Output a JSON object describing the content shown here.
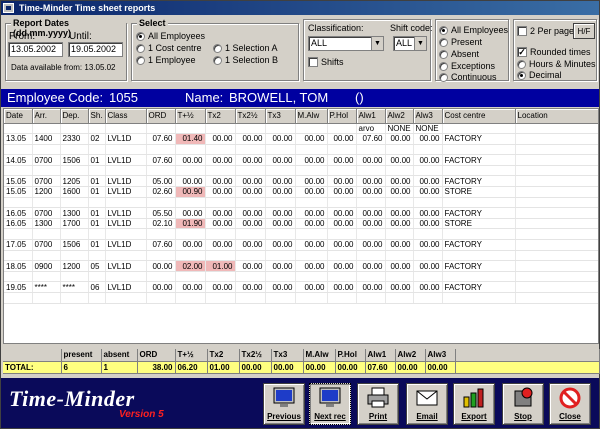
{
  "window": {
    "title": "Time-Minder Time sheet reports"
  },
  "report_dates": {
    "legend": "Report Dates (dd.mm.yyyy)",
    "from_label": "From:",
    "from_value": "13.05.2002",
    "until_label": "Until:",
    "until_value": "19.05.2002",
    "available": "Data available from:  13.05.02"
  },
  "select": {
    "legend": "Select",
    "all_employees": "All Employees",
    "one_cost_centre": "1 Cost centre",
    "one_employee": "1 Employee",
    "one_selection_a": "1 Selection A",
    "one_selection_b": "1 Selection B"
  },
  "classification": {
    "label": "Classification:",
    "value": "ALL"
  },
  "shift_code": {
    "label": "Shift code:",
    "value": "ALL"
  },
  "shifts": {
    "label": "Shifts"
  },
  "filter": {
    "all_employees": "All Employees",
    "present": "Present",
    "absent": "Absent",
    "exceptions": "Exceptions",
    "continuous": "Continuous"
  },
  "options": {
    "two_per_page": "2 Per page",
    "hf_button": "H/F",
    "rounded_times": "Rounded times",
    "hours_minutes": "Hours & Minutes",
    "decimal": "Decimal"
  },
  "employee": {
    "code_label": "Employee Code:",
    "code": "1055",
    "name_label": "Name:",
    "name": "BROWELL, TOM",
    "extra": "()"
  },
  "columns": [
    "Date",
    "Arr.",
    "Dep.",
    "Sh.",
    "Class",
    "ORD",
    "T+½",
    "Tx2",
    "Tx2½",
    "Tx3",
    "M.Alw",
    "P.Hol",
    "Alw1",
    "Alw2",
    "Alw3",
    "Cost centre",
    "Location"
  ],
  "subheader": {
    "alw1": "arvo",
    "alw2": "NONE",
    "alw3": "NONE"
  },
  "rows": [
    {
      "date": "13.05",
      "arr": "1400",
      "dep": "2330",
      "sh": "02",
      "cls": "LVL1D",
      "ord": "07.60",
      "t15": "01.40",
      "tx2": "00.00",
      "tx25": "00.00",
      "tx3": "00.00",
      "malw": "00.00",
      "phol": "00.00",
      "alw1": "07.60",
      "alw2": "00.00",
      "alw3": "00.00",
      "cc": "FACTORY",
      "loc": "",
      "h15": true,
      "h2": false,
      "gap": true
    },
    {
      "date": "14.05",
      "arr": "0700",
      "dep": "1506",
      "sh": "01",
      "cls": "LVL1D",
      "ord": "07.60",
      "t15": "00.00",
      "tx2": "00.00",
      "tx25": "00.00",
      "tx3": "00.00",
      "malw": "00.00",
      "phol": "00.00",
      "alw1": "00.00",
      "alw2": "00.00",
      "alw3": "00.00",
      "cc": "FACTORY",
      "loc": "",
      "h15": false,
      "h2": false,
      "gap": true
    },
    {
      "date": "15.05",
      "arr": "0700",
      "dep": "1205",
      "sh": "01",
      "cls": "LVL1D",
      "ord": "05.00",
      "t15": "00.00",
      "tx2": "00.00",
      "tx25": "00.00",
      "tx3": "00.00",
      "malw": "00.00",
      "phol": "00.00",
      "alw1": "00.00",
      "alw2": "00.00",
      "alw3": "00.00",
      "cc": "FACTORY",
      "loc": "",
      "h15": false,
      "h2": false,
      "gap": false
    },
    {
      "date": "15.05",
      "arr": "1200",
      "dep": "1600",
      "sh": "01",
      "cls": "LVL1D",
      "ord": "02.60",
      "t15": "00.90",
      "tx2": "00.00",
      "tx25": "00.00",
      "tx3": "00.00",
      "malw": "00.00",
      "phol": "00.00",
      "alw1": "00.00",
      "alw2": "00.00",
      "alw3": "00.00",
      "cc": "STORE",
      "loc": "",
      "h15": true,
      "h2": false,
      "gap": true
    },
    {
      "date": "16.05",
      "arr": "0700",
      "dep": "1300",
      "sh": "01",
      "cls": "LVL1D",
      "ord": "05.50",
      "t15": "00.00",
      "tx2": "00.00",
      "tx25": "00.00",
      "tx3": "00.00",
      "malw": "00.00",
      "phol": "00.00",
      "alw1": "00.00",
      "alw2": "00.00",
      "alw3": "00.00",
      "cc": "FACTORY",
      "loc": "",
      "h15": false,
      "h2": false,
      "gap": false
    },
    {
      "date": "16.05",
      "arr": "1300",
      "dep": "1700",
      "sh": "01",
      "cls": "LVL1D",
      "ord": "02.10",
      "t15": "01.90",
      "tx2": "00.00",
      "tx25": "00.00",
      "tx3": "00.00",
      "malw": "00.00",
      "phol": "00.00",
      "alw1": "00.00",
      "alw2": "00.00",
      "alw3": "00.00",
      "cc": "STORE",
      "loc": "",
      "h15": true,
      "h2": false,
      "gap": true
    },
    {
      "date": "17.05",
      "arr": "0700",
      "dep": "1506",
      "sh": "01",
      "cls": "LVL1D",
      "ord": "07.60",
      "t15": "00.00",
      "tx2": "00.00",
      "tx25": "00.00",
      "tx3": "00.00",
      "malw": "00.00",
      "phol": "00.00",
      "alw1": "00.00",
      "alw2": "00.00",
      "alw3": "00.00",
      "cc": "FACTORY",
      "loc": "",
      "h15": false,
      "h2": false,
      "gap": true
    },
    {
      "date": "18.05",
      "arr": "0900",
      "dep": "1200",
      "sh": "05",
      "cls": "LVL1D",
      "ord": "00.00",
      "t15": "02.00",
      "tx2": "01.00",
      "tx25": "00.00",
      "tx3": "00.00",
      "malw": "00.00",
      "phol": "00.00",
      "alw1": "00.00",
      "alw2": "00.00",
      "alw3": "00.00",
      "cc": "FACTORY",
      "loc": "",
      "h15": true,
      "h2": true,
      "gap": true
    },
    {
      "date": "19.05",
      "arr": "****",
      "dep": "****",
      "sh": "06",
      "cls": "LVL1D",
      "ord": "00.00",
      "t15": "00.00",
      "tx2": "00.00",
      "tx25": "00.00",
      "tx3": "00.00",
      "malw": "00.00",
      "phol": "00.00",
      "alw1": "00.00",
      "alw2": "00.00",
      "alw3": "00.00",
      "cc": "FACTORY",
      "loc": "",
      "h15": false,
      "h2": false,
      "gap": true
    }
  ],
  "totals": {
    "headers": [
      "",
      "present",
      "absent",
      "ORD",
      "T+½",
      "Tx2",
      "Tx2½",
      "Tx3",
      "M.Alw",
      "P.Hol",
      "Alw1",
      "Alw2",
      "Alw3",
      ""
    ],
    "label": "TOTAL:",
    "present": "6",
    "absent": "1",
    "ord": "38.00",
    "t15": "06.20",
    "tx2": "01.00",
    "tx25": "00.00",
    "tx3": "00.00",
    "malw": "00.00",
    "phol": "00.00",
    "alw1": "07.60",
    "alw2": "00.00",
    "alw3": "00.00"
  },
  "brand": {
    "name": "Time-Minder",
    "version": "Version 5"
  },
  "toolbar": {
    "previous": "Previous",
    "next": "Next rec",
    "print": "Print",
    "email": "Email",
    "export": "Export",
    "stop": "Stop",
    "close": "Close"
  },
  "colors": {
    "title_bar": "#0a246a",
    "employee_bar": "#0000a0",
    "highlight": "#f0b8b8",
    "totals_row": "#ffff80",
    "bottom_panel": "#0a0a5a"
  }
}
